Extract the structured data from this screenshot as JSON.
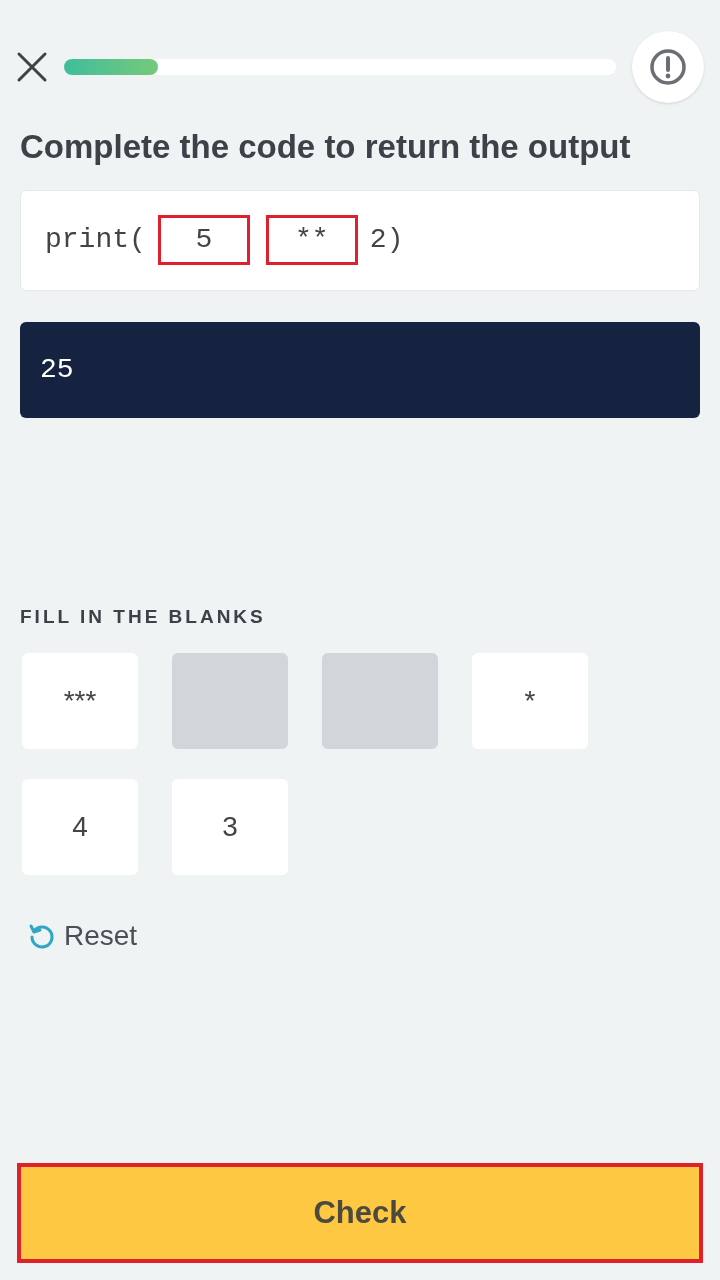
{
  "progress": {
    "level": 0.17
  },
  "title": "Complete the code to return the output",
  "code": [
    {
      "kind": "text",
      "text": "print("
    },
    {
      "kind": "blank",
      "text": "5",
      "highlighted": true
    },
    {
      "kind": "blank",
      "text": "**",
      "highlighted": true
    },
    {
      "kind": "text",
      "text": "2)"
    }
  ],
  "output": "25",
  "section_label": "FILL IN THE BLANKS",
  "options": [
    {
      "label": "***",
      "used": false
    },
    {
      "used": true
    },
    {
      "used": true
    },
    {
      "label": "*",
      "used": false
    },
    {
      "label": "4",
      "used": false
    },
    {
      "label": "3",
      "used": false
    }
  ],
  "reset": "Reset",
  "check_button": {
    "label": "Check",
    "highlighted": true
  }
}
